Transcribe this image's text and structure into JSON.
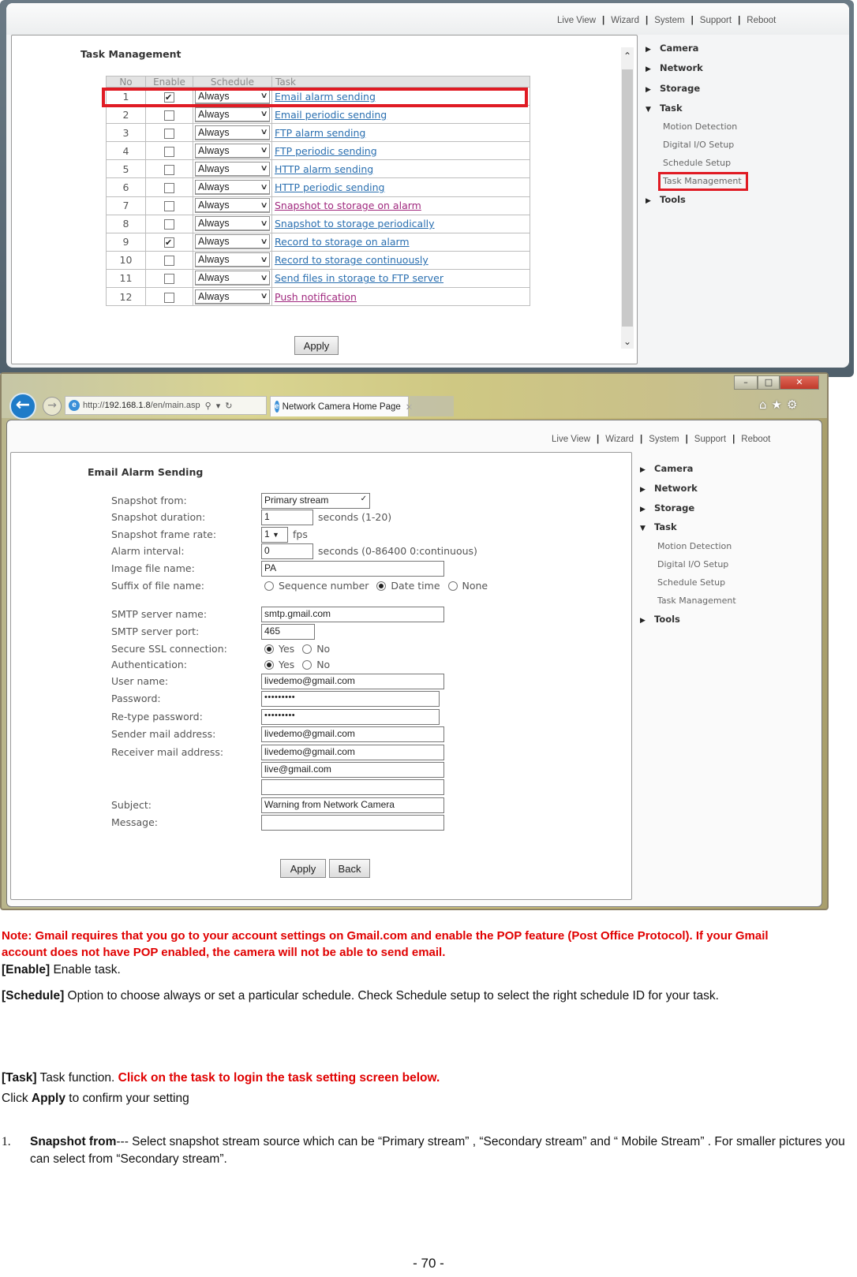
{
  "top_nav": [
    "Live View",
    "Wizard",
    "System",
    "Support",
    "Reboot"
  ],
  "side_menu": {
    "sections": [
      {
        "label": "Camera",
        "expanded": false
      },
      {
        "label": "Network",
        "expanded": false
      },
      {
        "label": "Storage",
        "expanded": false
      },
      {
        "label": "Task",
        "expanded": true
      },
      {
        "label": "Tools",
        "expanded": false
      }
    ],
    "task_subitems": [
      "Motion Detection",
      "Digital I/O Setup",
      "Schedule Setup",
      "Task Management"
    ],
    "selected": "Task Management"
  },
  "task_management": {
    "title": "Task Management",
    "columns": [
      "No",
      "Enable",
      "Schedule",
      "Task"
    ],
    "rows": [
      {
        "no": "1",
        "enabled": true,
        "schedule": "Always",
        "task": "Email alarm sending",
        "visited": false
      },
      {
        "no": "2",
        "enabled": false,
        "schedule": "Always",
        "task": "Email periodic sending",
        "visited": false
      },
      {
        "no": "3",
        "enabled": false,
        "schedule": "Always",
        "task": "FTP alarm sending",
        "visited": false
      },
      {
        "no": "4",
        "enabled": false,
        "schedule": "Always",
        "task": "FTP periodic sending",
        "visited": false
      },
      {
        "no": "5",
        "enabled": false,
        "schedule": "Always",
        "task": "HTTP alarm sending",
        "visited": false
      },
      {
        "no": "6",
        "enabled": false,
        "schedule": "Always",
        "task": "HTTP periodic sending",
        "visited": false
      },
      {
        "no": "7",
        "enabled": false,
        "schedule": "Always",
        "task": "Snapshot to storage on alarm",
        "visited": true
      },
      {
        "no": "8",
        "enabled": false,
        "schedule": "Always",
        "task": "Snapshot to storage periodically",
        "visited": false
      },
      {
        "no": "9",
        "enabled": true,
        "schedule": "Always",
        "task": "Record to storage on alarm",
        "visited": false
      },
      {
        "no": "10",
        "enabled": false,
        "schedule": "Always",
        "task": "Record to storage continuously",
        "visited": false
      },
      {
        "no": "11",
        "enabled": false,
        "schedule": "Always",
        "task": "Send files in storage to FTP server",
        "visited": false
      },
      {
        "no": "12",
        "enabled": false,
        "schedule": "Always",
        "task": "Push notification",
        "visited": true
      }
    ],
    "apply_label": "Apply"
  },
  "browser": {
    "url_prefix": "http://",
    "url_host": "192.168.1.8",
    "url_path": "/en/main.asp",
    "tab_title": "Network Camera Home Page",
    "window_controls": {
      "minimize": "–",
      "maximize": "□",
      "close": "✕"
    },
    "toolbar_icons": {
      "home": "⌂",
      "favorites": "★",
      "settings": "⚙"
    }
  },
  "email_alarm": {
    "title": "Email Alarm Sending",
    "labels": {
      "snapshot_from": "Snapshot from:",
      "snapshot_duration": "Snapshot duration:",
      "snapshot_frame_rate": "Snapshot frame rate:",
      "alarm_interval": "Alarm interval:",
      "image_file_name": "Image file name:",
      "suffix": "Suffix of file name:",
      "smtp_name": "SMTP server name:",
      "smtp_port": "SMTP server port:",
      "ssl": "Secure SSL connection:",
      "auth": "Authentication:",
      "user": "User name:",
      "password": "Password:",
      "retype": "Re-type password:",
      "sender": "Sender mail address:",
      "receiver": "Receiver mail address:",
      "subject": "Subject:",
      "message": "Message:"
    },
    "values": {
      "snapshot_from": "Primary stream",
      "snapshot_duration": "1",
      "snapshot_duration_hint": "seconds (1-20)",
      "frame_rate": "1",
      "frame_rate_unit": "fps",
      "alarm_interval": "0",
      "alarm_interval_hint": "seconds (0-86400 0:continuous)",
      "image_file_name": "PA",
      "suffix_options": [
        "Sequence number",
        "Date time",
        "None"
      ],
      "suffix_selected": "Date time",
      "smtp_name": "smtp.gmail.com",
      "smtp_port": "465",
      "ssl_options": [
        "Yes",
        "No"
      ],
      "ssl_selected": "Yes",
      "auth_options": [
        "Yes",
        "No"
      ],
      "auth_selected": "Yes",
      "user": "livedemo@gmail.com",
      "password": "•••••••••",
      "retype": "•••••••••",
      "sender": "livedemo@gmail.com",
      "receivers": [
        "livedemo@gmail.com",
        "live@gmail.com",
        ""
      ],
      "subject": "Warning from Network Camera",
      "message": ""
    },
    "apply_label": "Apply",
    "back_label": "Back"
  },
  "doc": {
    "note": "Note: Gmail requires that you go to your account settings on Gmail.com and enable the POP feature (Post Office Protocol). If your Gmail account does not have POP enabled, the camera will not be able to send email.",
    "enable_term": "[Enable]",
    "enable_desc": " Enable task.",
    "schedule_term": "[Schedule]",
    "schedule_desc": " Option to choose always or set a particular schedule. Check Schedule setup to select the right schedule ID for your task.",
    "task_term": "[Task]",
    "task_desc": " Task function. ",
    "task_red": "Click on the task to login the task setting screen below.",
    "click_prefix": "Click ",
    "click_bold": "Apply",
    "click_suffix": " to confirm your setting",
    "list_num": "1.",
    "list_term": "Snapshot from",
    "list_desc": "--- Select snapshot stream source which can be “Primary stream” , “Secondary stream” and “ Mobile Stream” . For smaller pictures you can select from “Secondary stream”.",
    "page_number": "- 70 -"
  },
  "colors": {
    "highlight_red": "#e01b24",
    "link_blue": "#2a6fb0",
    "link_visited": "#a0287e",
    "note_red": "#e00000"
  }
}
